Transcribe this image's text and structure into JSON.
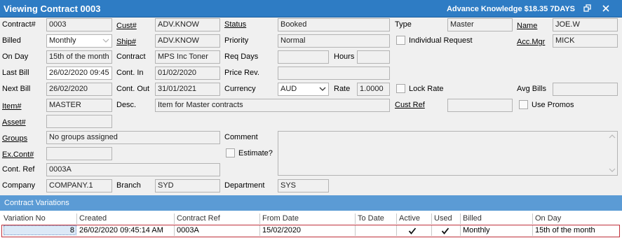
{
  "window": {
    "title": "Viewing Contract 0003",
    "info": "Advance Knowledge $18.35 7DAYS"
  },
  "form": {
    "contract_no_label": "Contract#",
    "contract_no": "0003",
    "cust_label": "Cust#",
    "cust": "ADV.KNOW",
    "status_label": "Status",
    "status": "Booked",
    "type_label": "Type",
    "type": "Master",
    "name_label": "Name",
    "name": "JOE.W",
    "billed_label": "Billed",
    "billed": "Monthly",
    "ship_label": "Ship#",
    "ship": "ADV.KNOW",
    "priority_label": "Priority",
    "priority": "Normal",
    "individual_request_label": "Individual Request",
    "acc_mgr_label": "Acc.Mgr",
    "acc_mgr": "MICK",
    "on_day_label": "On Day",
    "on_day": "15th of the month",
    "contract_label": "Contract",
    "contract": "MPS Inc Toner",
    "req_days_label": "Req Days",
    "req_days": "",
    "hours_label": "Hours",
    "hours": "",
    "last_bill_label": "Last Bill",
    "last_bill": "26/02/2020 09:45",
    "cont_in_label": "Cont. In",
    "cont_in": "01/02/2020",
    "price_rev_label": "Price Rev.",
    "price_rev": "",
    "next_bill_label": "Next Bill",
    "next_bill": "26/02/2020",
    "cont_out_label": "Cont. Out",
    "cont_out": "31/01/2021",
    "currency_label": "Currency",
    "currency": "AUD",
    "rate_label": "Rate",
    "rate": "1.0000",
    "lock_rate_label": "Lock Rate",
    "avg_bills_label": "Avg Bills",
    "avg_bills": "",
    "item_label": "Item#",
    "item": "MASTER",
    "desc_label": "Desc.",
    "desc": "Item for Master contracts",
    "cust_ref_label": "Cust Ref",
    "cust_ref": "",
    "use_promos_label": "Use Promos",
    "asset_label": "Asset#",
    "asset": "",
    "groups_label": "Groups",
    "groups": "No groups assigned",
    "comment_label": "Comment",
    "estimate_label": "Estimate?",
    "ex_cont_label": "Ex.Cont#",
    "ex_cont": "",
    "cont_ref_label": "Cont. Ref",
    "cont_ref": "0003A",
    "company_label": "Company",
    "company": "COMPANY.1",
    "branch_label": "Branch",
    "branch": "SYD",
    "department_label": "Department",
    "department": "SYS"
  },
  "variations": {
    "title": "Contract Variations",
    "columns": [
      "Variation No",
      "Created",
      "Contract Ref",
      "From Date",
      "To Date",
      "Active",
      "Used",
      "Billed",
      "On Day"
    ],
    "rows": [
      {
        "variation_no": "8",
        "created": "26/02/2020 09:45:14 AM",
        "contract_ref": "0003A",
        "from_date": "15/02/2020",
        "to_date": "",
        "active": true,
        "used": true,
        "billed": "Monthly",
        "on_day": "15th of the month"
      }
    ]
  },
  "icons": [
    "restore-icon",
    "close-icon",
    "chevron-down-icon",
    "scroll-up-icon",
    "scroll-down-icon",
    "checkmark-icon"
  ],
  "colors": {
    "title_bar": "#2e7cc4",
    "section_bar": "#5b9bd5",
    "selected_row_border": "#c0323c"
  }
}
